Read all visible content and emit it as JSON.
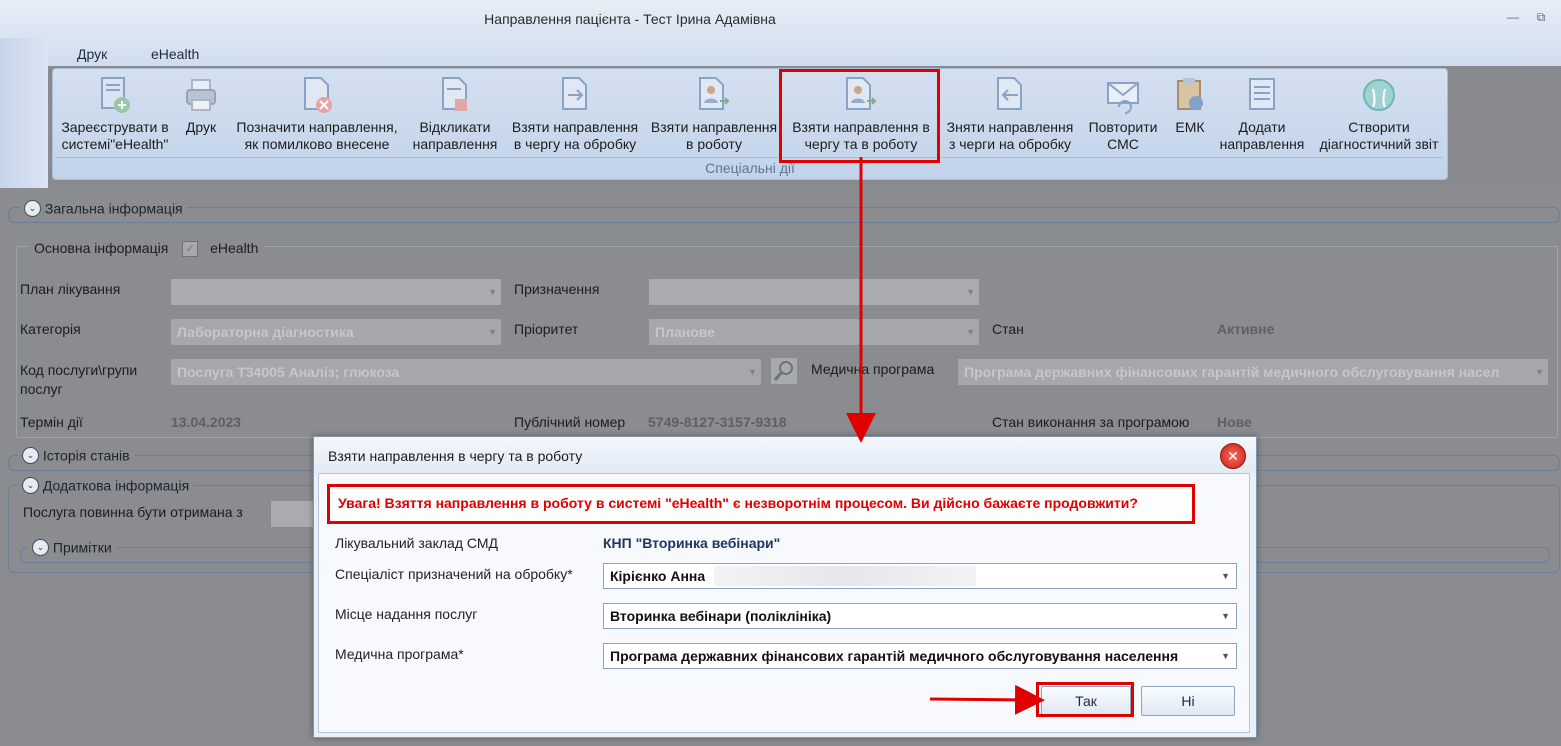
{
  "window": {
    "title": "Направлення пацієнта - Тест Ірина Адамівна",
    "minimize_glyph": "—",
    "restore_glyph": "⧉"
  },
  "menu": {
    "items": [
      "Друк",
      "eHealth"
    ]
  },
  "ribbon": {
    "group_label": "Спеціальні дії",
    "buttons": [
      {
        "label1": "Зареєструвати в",
        "label2": "системі\"eHealth\"",
        "icon": "register-icon"
      },
      {
        "label1": "Друк",
        "label2": "",
        "icon": "printer-icon"
      },
      {
        "label1": "Позначити направлення,",
        "label2": "як помилково внесене",
        "icon": "mark-error-icon"
      },
      {
        "label1": "Відкликати",
        "label2": "направлення",
        "icon": "revoke-icon"
      },
      {
        "label1": "Взяти направлення",
        "label2": "в чергу на обробку",
        "icon": "queue-icon"
      },
      {
        "label1": "Взяти направлення",
        "label2": "в роботу",
        "icon": "take-to-work-icon"
      },
      {
        "label1": "Взяти направлення в",
        "label2": "чергу та в роботу",
        "icon": "queue-and-work-icon"
      },
      {
        "label1": "Зняти направлення",
        "label2": "з черги на обробку",
        "icon": "remove-from-queue-icon"
      },
      {
        "label1": "Повторити",
        "label2": "СМС",
        "icon": "sms-icon"
      },
      {
        "label1": "ЕМК",
        "label2": "",
        "icon": "emk-icon"
      },
      {
        "label1": "Додати",
        "label2": "направлення",
        "icon": "add-referral-icon"
      },
      {
        "label1": "Створити",
        "label2": "діагностичний звіт",
        "icon": "diagnostic-report-icon"
      }
    ]
  },
  "sections": {
    "general": "Загальна інформація",
    "basic": "Основна інформація",
    "ehealth_checkbox": "eHealth",
    "history": "Історія станів",
    "additional": "Додаткова інформація",
    "notes": "Примітки"
  },
  "form": {
    "plan_label": "План лікування",
    "plan_value": "",
    "purpose_label": "Призначення",
    "purpose_value": "",
    "category_label": "Категорія",
    "category_value": "Лабораторна діагностика",
    "priority_label": "Пріоритет",
    "priority_value": "Планове",
    "status_label": "Стан",
    "status_value": "Активне",
    "service_label1": "Код послуги\\групи",
    "service_label2": "послуг",
    "service_value": "Послуга Т34005 Аналіз; глюкоза",
    "medprog_label": "Медична програма",
    "medprog_value": "Програма державних фінансових гарантій медичного обслуговування насел",
    "term_label": "Термін дії",
    "term_value": "13.04.2023",
    "public_label": "Публічний номер",
    "public_value": "5749-8127-3157-9318",
    "exec_label": "Стан виконання за програмою",
    "exec_value": "Нове",
    "service_received_label": "Послуга повинна бути отримана з"
  },
  "dialog": {
    "title": "Взяти направлення в чергу та в роботу",
    "close_glyph": "✕",
    "warning": "Увага! Взяття направлення в роботу в системі \"eHealth\" є незворотнім процесом. Ви дійсно бажаєте продовжити?",
    "facility_label": "Лікувальний заклад СМД",
    "facility_value": "КНП \"Вторинка вебінари\"",
    "specialist_label": "Спеціаліст призначений на обробку*",
    "specialist_value": "Кірієнко Анна",
    "place_label": "Місце надання послуг",
    "place_value": "Вторинка вебінари (поліклініка)",
    "program_label": "Медична програма*",
    "program_value": "Програма державних фінансових гарантій медичного обслуговування населення",
    "ok": "Так",
    "no": "Ні"
  },
  "colors": {
    "highlight": "#e00000",
    "ribbon": "#c8d7ec",
    "dialog_value": "#1d3760"
  }
}
